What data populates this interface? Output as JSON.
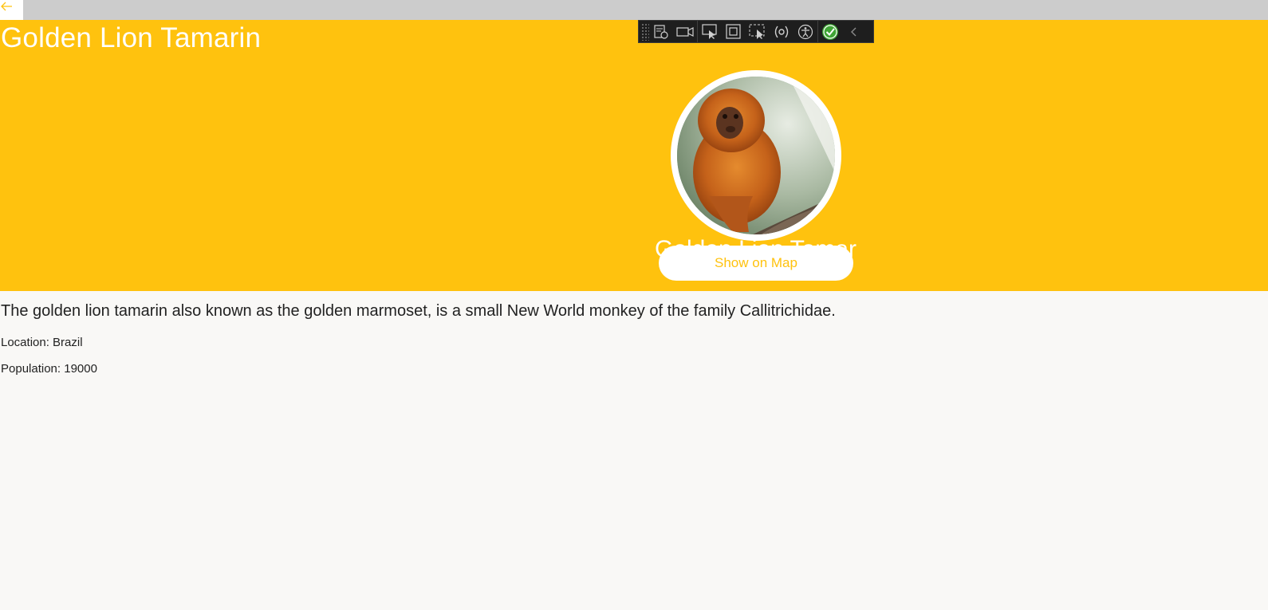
{
  "window": {
    "back_icon": "arrow-left-icon"
  },
  "header": {
    "title": "Golden Lion Tamarin",
    "hidden_name": "Golden Lion Tamarin",
    "background_color": "#ffc20e",
    "map_button_label": "Show on Map",
    "image_alt": "Golden lion tamarin photo"
  },
  "devtools": {
    "tools": [
      "live-visual-tree-icon",
      "record-icon",
      "select-element-icon",
      "display-layout-adorners-icon",
      "track-focus-icon",
      "binding-failures-icon",
      "accessibility-checker-icon",
      "status-ok-icon",
      "collapse-icon"
    ]
  },
  "details": {
    "description": "The golden lion tamarin also known as the golden marmoset, is a small New World monkey of the family Callitrichidae.",
    "location": "Location: Brazil",
    "population": "Population: 19000"
  }
}
